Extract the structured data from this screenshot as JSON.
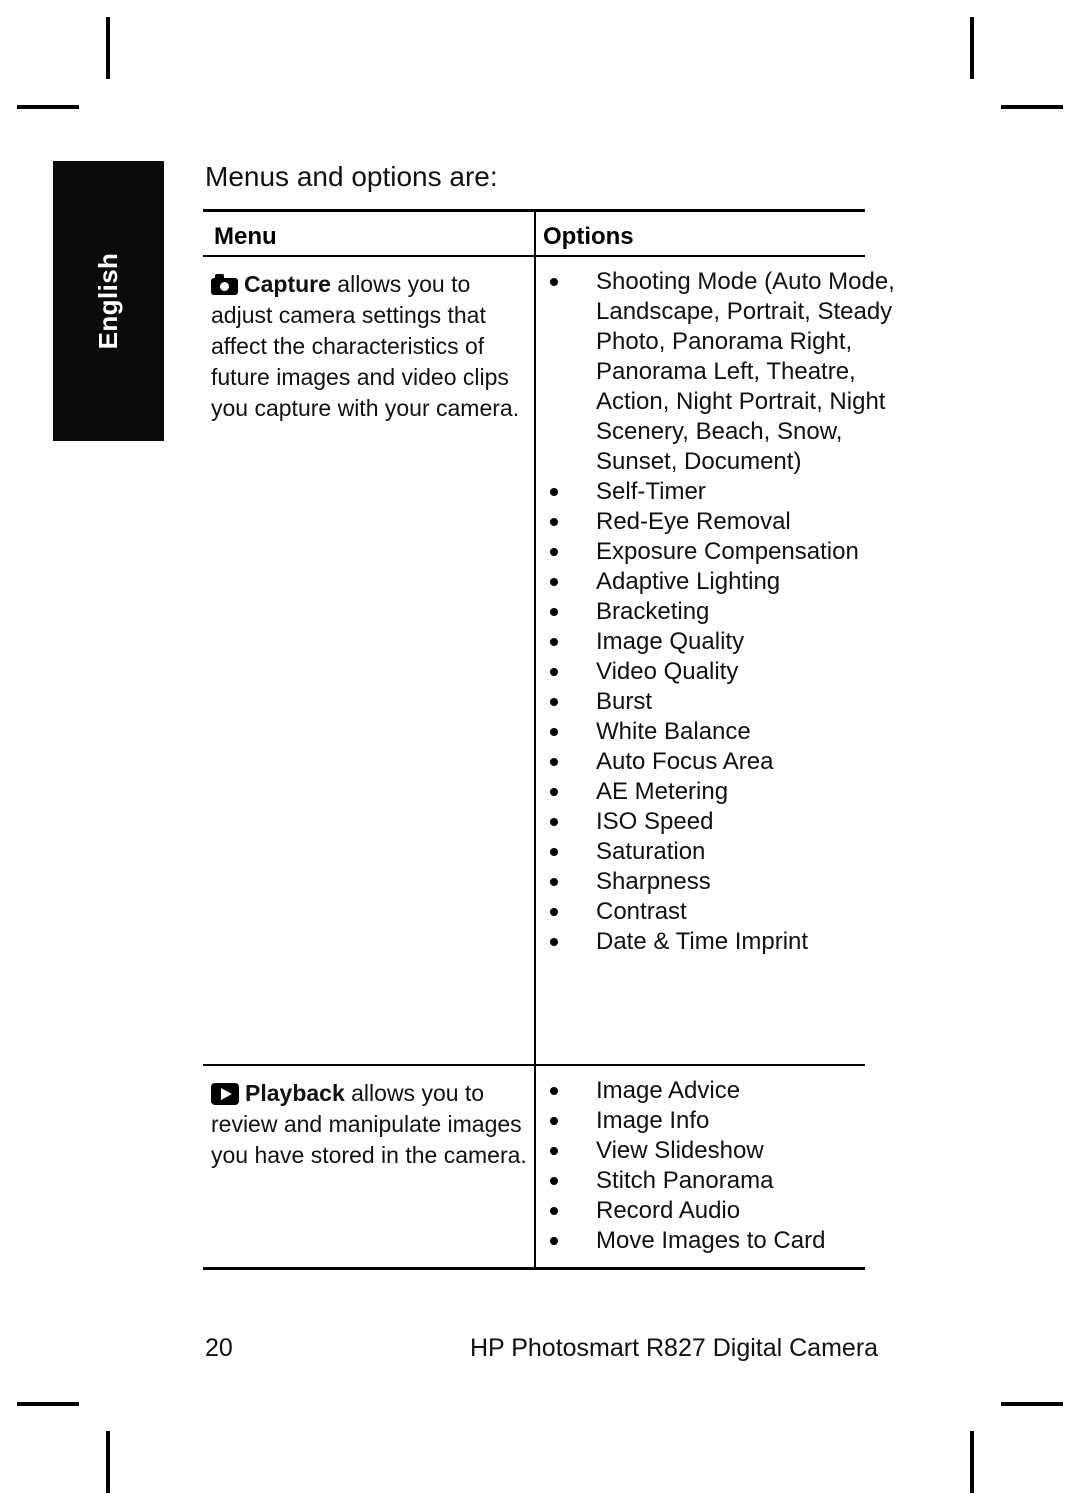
{
  "page": {
    "language_tab": "English",
    "intro": "Menus and options are:",
    "footer": {
      "page_number": "20",
      "product_name": "HP Photosmart R827 Digital Camera"
    }
  },
  "table": {
    "headers": {
      "menu": "Menu",
      "options": "Options"
    },
    "rows": [
      {
        "icon": "camera-icon",
        "menu_name": "Capture",
        "menu_description": " allows you to adjust camera settings that affect the characteristics of future images and video clips you capture with your camera.",
        "options": [
          "Shooting Mode (Auto Mode, Landscape, Portrait, Steady Photo, Panorama Right, Panorama Left, Theatre, Action, Night Portrait, Night Scenery, Beach, Snow, Sunset, Document)",
          "Self-Timer",
          "Red-Eye Removal",
          "Exposure Compensation",
          "Adaptive Lighting",
          "Bracketing",
          "Image Quality",
          "Video Quality",
          "Burst",
          "White Balance",
          "Auto Focus Area",
          "AE Metering",
          "ISO Speed",
          "Saturation",
          "Sharpness",
          "Contrast",
          "Date & Time Imprint"
        ]
      },
      {
        "icon": "playback-icon",
        "menu_name": "Playback",
        "menu_description": " allows you to review and manipulate images you have stored in the camera.",
        "options": [
          "Image Advice",
          "Image Info",
          "View Slideshow",
          "Stitch Panorama",
          "Record Audio",
          "Move Images to Card"
        ]
      }
    ]
  },
  "colors": {
    "ink": "#000000",
    "paper": "#ffffff",
    "tab_background": "#0b0b0b",
    "tab_text": "#ffffff"
  }
}
